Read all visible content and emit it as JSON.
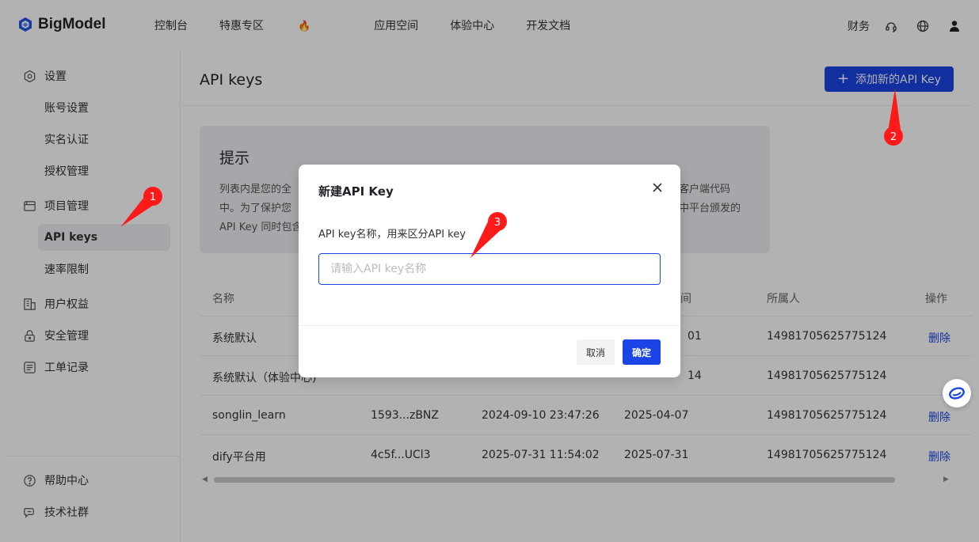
{
  "brand": {
    "name": "BigModel"
  },
  "topnav": [
    {
      "label": "控制台"
    },
    {
      "label": "特惠专区"
    },
    {
      "label": "应用空间"
    },
    {
      "label": "体验中心"
    },
    {
      "label": "开发文档"
    }
  ],
  "topnav_fire_icon": "fire-icon",
  "header_right": {
    "finance": "财务",
    "icons": [
      "headset-icon",
      "globe-icon",
      "user-icon"
    ]
  },
  "sidebar": {
    "groups": [
      {
        "label": "设置",
        "icon": "settings-icon"
      },
      {
        "label": "项目管理",
        "icon": "folder-icon"
      },
      {
        "label": "用户权益",
        "icon": "building-icon"
      },
      {
        "label": "安全管理",
        "icon": "lock-icon"
      },
      {
        "label": "工单记录",
        "icon": "ticket-icon"
      }
    ],
    "sub_items": {
      "account": "账号设置",
      "realname": "实名认证",
      "auth": "授权管理",
      "apikeys": "API keys",
      "ratelimit": "速率限制"
    },
    "bottom": [
      {
        "label": "帮助中心",
        "icon": "help-icon"
      },
      {
        "label": "技术社群",
        "icon": "chat-icon"
      }
    ]
  },
  "main": {
    "title": "API keys",
    "add_button": "添加新的API Key",
    "tip": {
      "title": "提示",
      "lines_left": [
        "列表内是您的全",
        "中。为了保护您",
        "API Key 同时包含"
      ],
      "lines_right": [
        "客户端代码",
        "中平台颁发的"
      ]
    },
    "table": {
      "headers": [
        "名称",
        "间",
        "所属人",
        "操作"
      ],
      "rows": [
        {
          "name": "系统默认",
          "key": "",
          "created": "",
          "used": "01",
          "owner": "14981705625775124",
          "action": "删除"
        },
        {
          "name": "系统默认（体验中心)",
          "key": "",
          "created": "",
          "used": "14",
          "owner": "14981705625775124",
          "action": ""
        },
        {
          "name": "songlin_learn",
          "key": "1593...zBNZ",
          "created": "2024-09-10 23:47:26",
          "used": "2025-04-07",
          "owner": "14981705625775124",
          "action": "删除"
        },
        {
          "name": "dify平台用",
          "key": "4c5f...UCl3",
          "created": "2025-07-31 11:54:02",
          "used": "2025-07-31",
          "owner": "14981705625775124",
          "action": "删除"
        }
      ]
    }
  },
  "dialog": {
    "title": "新建API Key",
    "label": "API key名称，用来区分API key",
    "placeholder": "请输入API key名称",
    "value": "",
    "cancel": "取消",
    "ok": "确定"
  },
  "annotations": {
    "markers": [
      "1",
      "2",
      "3"
    ],
    "color": "#ff1a1a"
  },
  "colors": {
    "accent": "#1b44e6",
    "sidebar_active_bg": "#eef0f5",
    "overlay": "rgba(0,0,0,0.3)"
  }
}
